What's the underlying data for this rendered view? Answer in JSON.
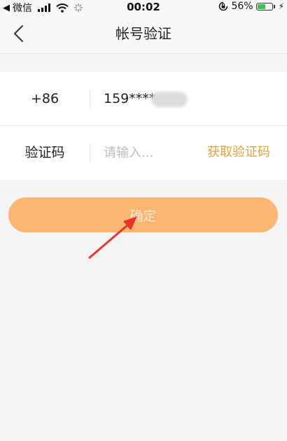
{
  "status_bar": {
    "back_app": "◀",
    "carrier": "微信",
    "time": "00:02",
    "battery": "56%",
    "battery_level": 0.56,
    "battery_color": "#3ac24a"
  },
  "nav": {
    "title": "帐号验证"
  },
  "form": {
    "phone": {
      "label": "+86",
      "value": "159****"
    },
    "code": {
      "label": "验证码",
      "placeholder": "请输入...",
      "value": "",
      "get_code_label": "获取验证码"
    }
  },
  "confirm": {
    "label": "确定"
  },
  "colors": {
    "accent": "#e0a43a",
    "confirm_bg": "#fbb672",
    "annotation_arrow": "#e8352b"
  }
}
